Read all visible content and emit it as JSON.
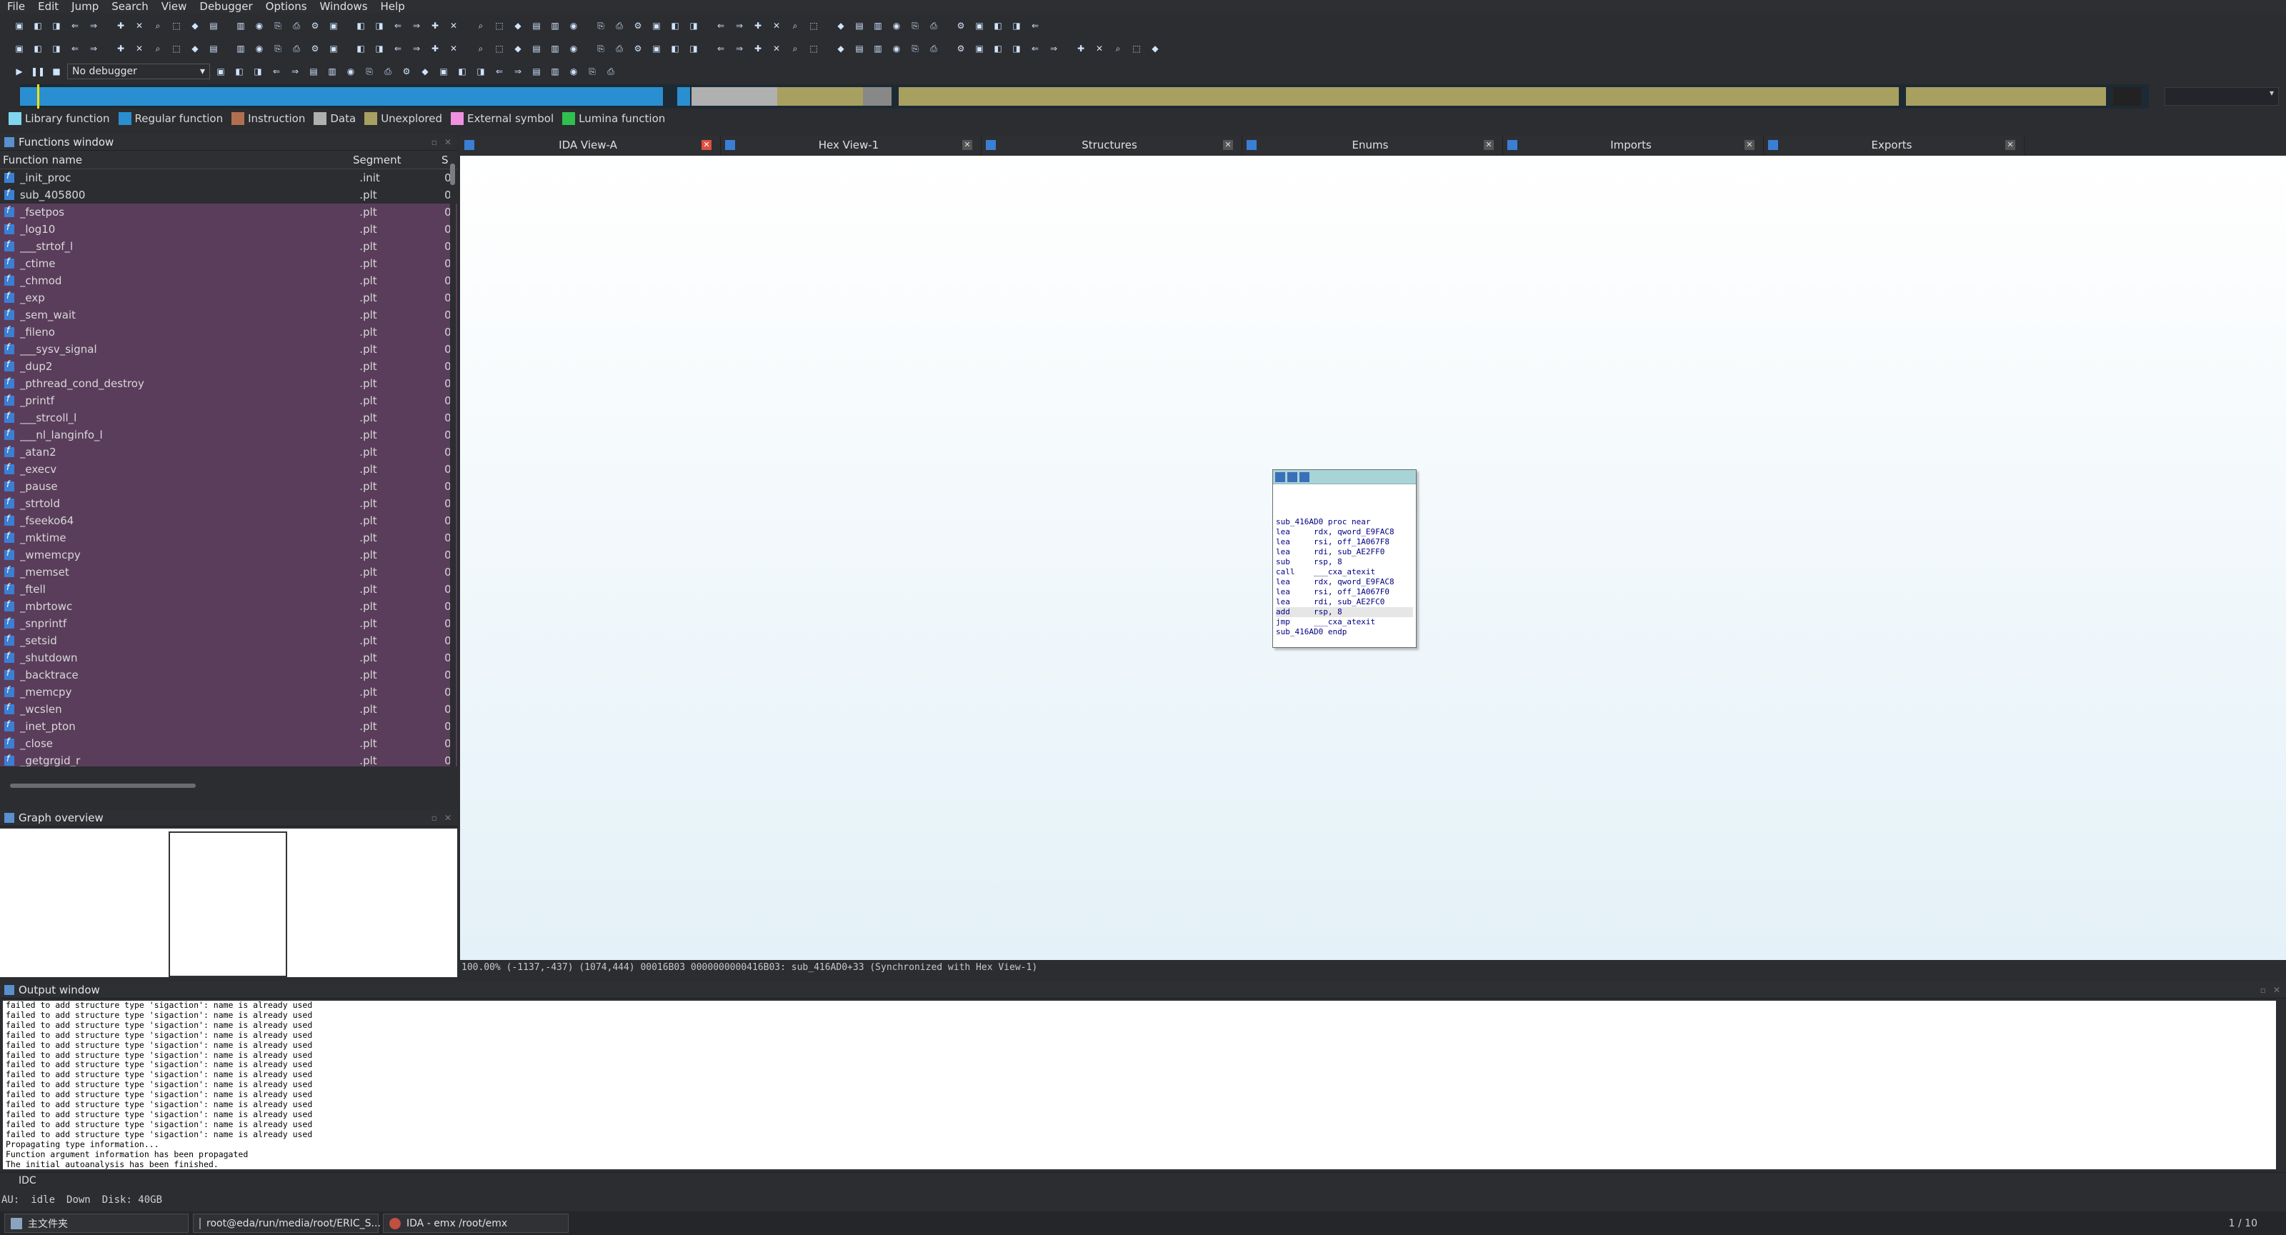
{
  "menu": [
    "File",
    "Edit",
    "Jump",
    "Search",
    "View",
    "Debugger",
    "Options",
    "Windows",
    "Help"
  ],
  "toolbar": {
    "debugger_select": "No debugger"
  },
  "legend": [
    {
      "label": "Library function",
      "color": "#7fd6f0"
    },
    {
      "label": "Regular function",
      "color": "#2a8fd0"
    },
    {
      "label": "Instruction",
      "color": "#b07050"
    },
    {
      "label": "Data",
      "color": "#b0b0b0"
    },
    {
      "label": "Unexplored",
      "color": "#a8a060"
    },
    {
      "label": "External symbol",
      "color": "#f090e0"
    },
    {
      "label": "Lumina function",
      "color": "#30c050"
    }
  ],
  "functions_window": {
    "title": "Functions window",
    "columns": [
      "Function name",
      "Segment",
      "S"
    ],
    "rows": [
      {
        "name": "_init_proc",
        "segment": ".init",
        "start": "0",
        "lib": false
      },
      {
        "name": "sub_405800",
        "segment": ".plt",
        "start": "0",
        "lib": false
      },
      {
        "name": "_fsetpos",
        "segment": ".plt",
        "start": "0",
        "lib": true
      },
      {
        "name": "_log10",
        "segment": ".plt",
        "start": "0",
        "lib": true
      },
      {
        "name": "___strtof_l",
        "segment": ".plt",
        "start": "0",
        "lib": true
      },
      {
        "name": "_ctime",
        "segment": ".plt",
        "start": "0",
        "lib": true
      },
      {
        "name": "_chmod",
        "segment": ".plt",
        "start": "0",
        "lib": true
      },
      {
        "name": "_exp",
        "segment": ".plt",
        "start": "0",
        "lib": true
      },
      {
        "name": "_sem_wait",
        "segment": ".plt",
        "start": "0",
        "lib": true
      },
      {
        "name": "_fileno",
        "segment": ".plt",
        "start": "0",
        "lib": true
      },
      {
        "name": "___sysv_signal",
        "segment": ".plt",
        "start": "0",
        "lib": true
      },
      {
        "name": "_dup2",
        "segment": ".plt",
        "start": "0",
        "lib": true
      },
      {
        "name": "_pthread_cond_destroy",
        "segment": ".plt",
        "start": "0",
        "lib": true
      },
      {
        "name": "_printf",
        "segment": ".plt",
        "start": "0",
        "lib": true
      },
      {
        "name": "___strcoll_l",
        "segment": ".plt",
        "start": "0",
        "lib": true
      },
      {
        "name": "___nl_langinfo_l",
        "segment": ".plt",
        "start": "0",
        "lib": true
      },
      {
        "name": "_atan2",
        "segment": ".plt",
        "start": "0",
        "lib": true
      },
      {
        "name": "_execv",
        "segment": ".plt",
        "start": "0",
        "lib": true
      },
      {
        "name": "_pause",
        "segment": ".plt",
        "start": "0",
        "lib": true
      },
      {
        "name": "_strtold",
        "segment": ".plt",
        "start": "0",
        "lib": true
      },
      {
        "name": "_fseeko64",
        "segment": ".plt",
        "start": "0",
        "lib": true
      },
      {
        "name": "_mktime",
        "segment": ".plt",
        "start": "0",
        "lib": true
      },
      {
        "name": "_wmemcpy",
        "segment": ".plt",
        "start": "0",
        "lib": true
      },
      {
        "name": "_memset",
        "segment": ".plt",
        "start": "0",
        "lib": true
      },
      {
        "name": "_ftell",
        "segment": ".plt",
        "start": "0",
        "lib": true
      },
      {
        "name": "_mbrtowc",
        "segment": ".plt",
        "start": "0",
        "lib": true
      },
      {
        "name": "_snprintf",
        "segment": ".plt",
        "start": "0",
        "lib": true
      },
      {
        "name": "_setsid",
        "segment": ".plt",
        "start": "0",
        "lib": true
      },
      {
        "name": "_shutdown",
        "segment": ".plt",
        "start": "0",
        "lib": true
      },
      {
        "name": "_backtrace",
        "segment": ".plt",
        "start": "0",
        "lib": true
      },
      {
        "name": "_memcpy",
        "segment": ".plt",
        "start": "0",
        "lib": true
      },
      {
        "name": "_wcslen",
        "segment": ".plt",
        "start": "0",
        "lib": true
      },
      {
        "name": "_inet_pton",
        "segment": ".plt",
        "start": "0",
        "lib": true
      },
      {
        "name": "_close",
        "segment": ".plt",
        "start": "0",
        "lib": true
      },
      {
        "name": "_getgrgid_r",
        "segment": ".plt",
        "start": "0",
        "lib": true
      }
    ]
  },
  "graph_overview": {
    "title": "Graph overview"
  },
  "tabs": [
    {
      "label": "IDA View-A",
      "active": true
    },
    {
      "label": "Hex View-1",
      "active": false
    },
    {
      "label": "Structures",
      "active": false
    },
    {
      "label": "Enums",
      "active": false
    },
    {
      "label": "Imports",
      "active": false
    },
    {
      "label": "Exports",
      "active": false
    }
  ],
  "graph_node": {
    "lines": [
      "sub_416AD0 proc near",
      "lea     rdx, qword_E9FAC8",
      "lea     rsi, off_1A067F8",
      "lea     rdi, sub_AE2FF0",
      "sub     rsp, 8",
      "call    ___cxa_atexit",
      "lea     rdx, qword_E9FAC8",
      "lea     rsi, off_1A067F0",
      "lea     rdi, sub_AE2FC0",
      "add     rsp, 8",
      "jmp     ___cxa_atexit",
      "sub_416AD0 endp"
    ],
    "highlight_line": 9
  },
  "graph_status": "100.00% (-1137,-437) (1074,444) 00016B03 0000000000416B03: sub_416AD0+33 (Synchronized with Hex View-1)",
  "output_window": {
    "title": "Output window",
    "lines": [
      "failed to add structure type 'sigaction': name is already used",
      "failed to add structure type 'sigaction': name is already used",
      "failed to add structure type 'sigaction': name is already used",
      "failed to add structure type 'sigaction': name is already used",
      "failed to add structure type 'sigaction': name is already used",
      "failed to add structure type 'sigaction': name is already used",
      "failed to add structure type 'sigaction': name is already used",
      "failed to add structure type 'sigaction': name is already used",
      "failed to add structure type 'sigaction': name is already used",
      "failed to add structure type 'sigaction': name is already used",
      "failed to add structure type 'sigaction': name is already used",
      "failed to add structure type 'sigaction': name is already used",
      "failed to add structure type 'sigaction': name is already used",
      "failed to add structure type 'sigaction': name is already used",
      "Propagating type information...",
      "Function argument information has been propagated",
      "The initial autoanalysis has been finished."
    ]
  },
  "idc_label": "IDC",
  "status": {
    "au": "AU:",
    "state": "idle",
    "direction": "Down",
    "disk": "Disk: 40GB"
  },
  "taskbar": {
    "items": [
      "主文件夹",
      "root@eda/run/media/root/ERIC_S...",
      "IDA - emx /root/emx"
    ],
    "pager": "1 / 10"
  }
}
